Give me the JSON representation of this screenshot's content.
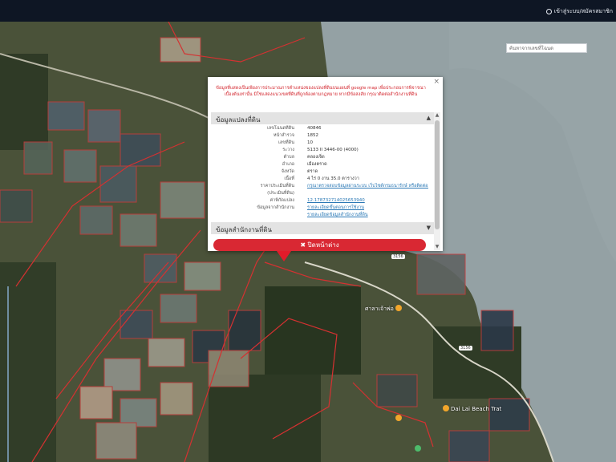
{
  "header": {
    "user_link": "เข้าสู่ระบบ/สมัครสมาชิก",
    "search_placeholder": "ค้นหาจากเลขที่โฉนด"
  },
  "popup": {
    "notice": "ข้อมูลที่แสดงเป็นเพียงการประมาณการตำแหน่งของแปลงที่ดินบนแผนที่ google map เพื่อประกอบการพิจารณาเบื้องต้นเท่านั้น มิใช่แสดงแนวเขตที่ดินที่ถูกต้องตามกฎหมาย หากมีข้อสงสัย กรุณาติดต่อสำนักงานที่ดิน",
    "section_parcel": "ข้อมูลแปลงที่ดิน",
    "section_office": "ข้อมูลสำนักงานที่ดิน",
    "close_button": "✖ ปิดหน้าต่าง",
    "rows": [
      {
        "label": "เลขโฉนดที่ดิน",
        "value": "40846"
      },
      {
        "label": "หน้าสำรวจ",
        "value": "1852"
      },
      {
        "label": "เลขที่ดิน",
        "value": "10"
      },
      {
        "label": "ระวาง",
        "value": "5133 II 3446-00 (4000)"
      },
      {
        "label": "ตำบล",
        "value": "คลองเจ็ด"
      },
      {
        "label": "อำเภอ",
        "value": "เมืองตราด"
      },
      {
        "label": "จังหวัด",
        "value": "ตราด"
      },
      {
        "label": "เนื้อที่",
        "value": "4 ไร่ 0 งาน 35.0 ตารางวา"
      },
      {
        "label": "ราคาประเมินที่ดิน",
        "value": "กรุณาตรวจสอบข้อมูลผ่านระบบ เว็บไซต์กรมธนารักษ์ หรือติดต่อสำนักงานที่ดิน",
        "link": true
      },
      {
        "label": "(ประเมินที่ดิน)",
        "value": ""
      },
      {
        "label": "ค่าพิกัดแปลง",
        "value": "12.178732714025653940",
        "link": true
      },
      {
        "label": "ข้อมูลจากสำนักงาน",
        "value": "รายละเอียดขั้นตอนการใช้งาน",
        "link": true
      },
      {
        "label": "",
        "value": "รายละเอียดข้อมูลสำนักงานที่ดิน",
        "link": true
      }
    ]
  },
  "map": {
    "poi_1": "ศาลาเจ้าพ่อ",
    "poi_2": "Dai Lai Beach Trat",
    "road_1": "3156",
    "road_2": "3156"
  }
}
